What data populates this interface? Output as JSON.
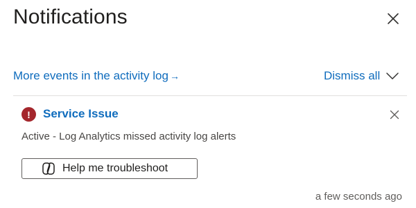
{
  "panel": {
    "title": "Notifications",
    "close_icon": "close-icon"
  },
  "toolbar": {
    "activity_log_link": "More events in the activity log",
    "activity_log_arrow": "→",
    "dismiss_all": "Dismiss all",
    "expand_icon": "chevron-down-icon"
  },
  "notifications": [
    {
      "status_icon": "error-icon",
      "status_glyph": "!",
      "title": "Service Issue",
      "description": "Active - Log Analytics missed activity log alerts",
      "action_icon": "copilot-icon",
      "action_label": "Help me troubleshoot",
      "timestamp": "a few seconds ago",
      "dismiss_icon": "close-icon"
    }
  ],
  "colors": {
    "link": "#0f6cbd",
    "error": "#a4262c",
    "divider": "#e1dfdd"
  }
}
